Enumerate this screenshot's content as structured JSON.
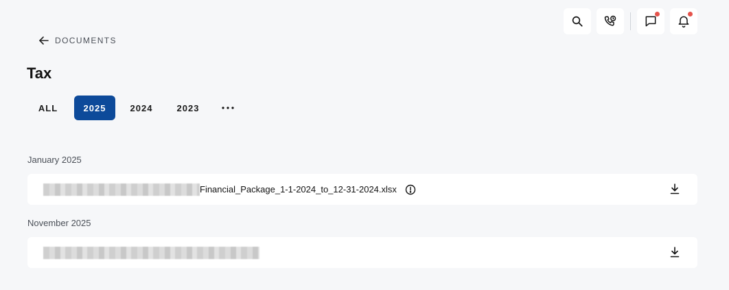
{
  "header": {
    "back_label": "DOCUMENTS",
    "title": "Tax",
    "icons": [
      "search-icon",
      "phone-icon",
      "chat-icon",
      "bell-icon"
    ],
    "notification_dot_color": "#e5534b"
  },
  "tabs": [
    {
      "label": "ALL",
      "active": false
    },
    {
      "label": "2025",
      "active": true
    },
    {
      "label": "2024",
      "active": false
    },
    {
      "label": "2023",
      "active": false
    },
    {
      "label": "•••",
      "active": false
    }
  ],
  "accent_color": "#0d4a9a",
  "sections": [
    {
      "label": "January 2025",
      "files": [
        {
          "name_visible": "Financial_Package_1-1-2024_to_12-31-2024.xlsx",
          "has_warning": true
        }
      ]
    },
    {
      "label": "November 2025",
      "files": [
        {
          "name_visible": "",
          "has_warning": false
        }
      ]
    }
  ]
}
